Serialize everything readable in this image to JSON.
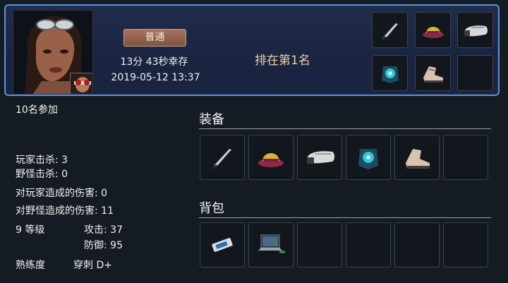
{
  "header": {
    "mode_label": "普通",
    "survival_time": "13分 43秒幸存",
    "datetime": "2019-05-12 13:37",
    "rank_text": "排在第1名"
  },
  "stats": {
    "participants": "10名参加",
    "player_kills": "玩家击杀: 3",
    "monster_kills": "野怪击杀: 0",
    "player_damage": "对玩家造成的伤害: 0",
    "monster_damage": "对野怪造成的伤害: 11",
    "level": "9 等级",
    "attack": "攻击: 37",
    "defense": "防御: 95",
    "proficiency_label": "熟练度",
    "proficiency_value": "穿刺 D+"
  },
  "sections": {
    "equipment_title": "装备",
    "backpack_title": "背包"
  },
  "icons": {
    "header_slots": [
      "knife-icon",
      "hat-icon",
      "gauntlet-icon",
      "armor-icon",
      "boots-icon",
      "empty-slot"
    ],
    "equipment_slots": [
      "knife-icon",
      "hat-icon",
      "gauntlet-icon",
      "armor-icon",
      "boots-icon",
      "empty-slot"
    ],
    "backpack_slots": [
      "phone-icon",
      "laptop-icon",
      "empty-slot",
      "empty-slot",
      "empty-slot",
      "empty-slot"
    ]
  },
  "colors": {
    "header_border": "#5b8fd6",
    "rank_text": "#e7d3a3",
    "badge_bg": "#8f6450"
  }
}
